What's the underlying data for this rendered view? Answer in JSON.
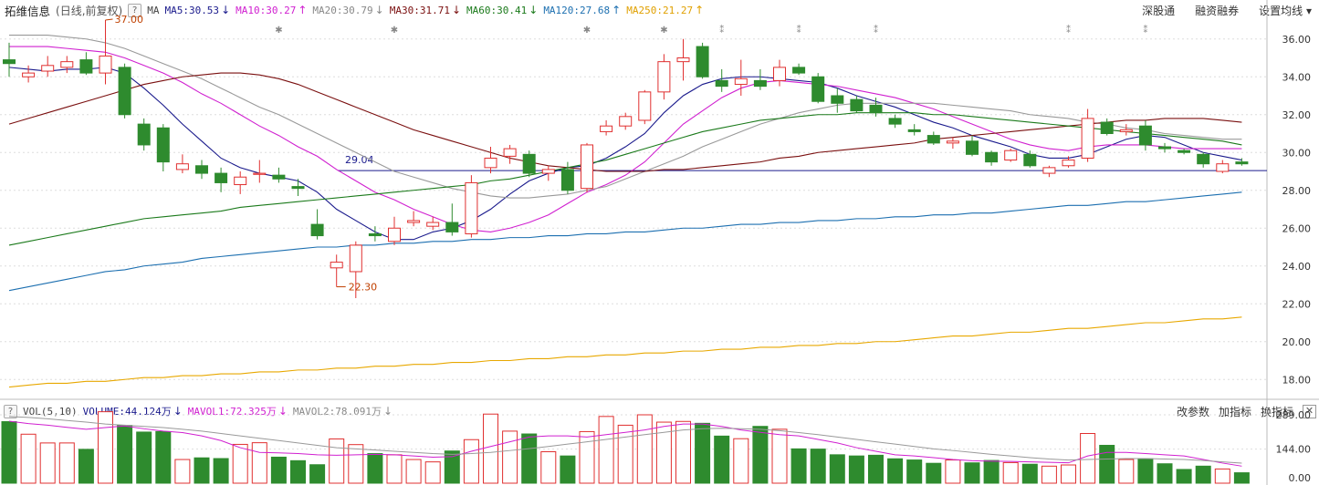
{
  "header": {
    "stock_name": "拓维信息",
    "mode": "(日线,前复权)",
    "help": "?",
    "ma_label": "MA",
    "ma_items": [
      {
        "label": "MA5:30.53",
        "arrow": "↓",
        "color": "#1a1a8c"
      },
      {
        "label": "MA10:30.27",
        "arrow": "↑",
        "color": "#d020d0"
      },
      {
        "label": "MA20:30.79",
        "arrow": "↓",
        "color": "#888888"
      },
      {
        "label": "MA30:31.71",
        "arrow": "↓",
        "color": "#7a0f0f"
      },
      {
        "label": "MA60:30.41",
        "arrow": "↓",
        "color": "#1b7a1b"
      },
      {
        "label": "MA120:27.68",
        "arrow": "↑",
        "color": "#1c6fb0"
      },
      {
        "label": "MA250:21.27",
        "arrow": "↑",
        "color": "#e0a000"
      }
    ],
    "links": [
      "深股通",
      "融资融券",
      "设置均线 ▾"
    ]
  },
  "volume_header": {
    "help": "?",
    "vol_label": "VOL(5,10)",
    "items": [
      {
        "label": "VOLUME:44.124万",
        "arrow": "↓",
        "color": "#1a1a8c"
      },
      {
        "label": "MAVOL1:72.325万",
        "arrow": "↓",
        "color": "#d020d0"
      },
      {
        "label": "MAVOL2:78.091万",
        "arrow": "↓",
        "color": "#888888"
      }
    ],
    "links": [
      "改参数",
      "加指标",
      "换指标"
    ],
    "close": "✕"
  },
  "chart_data": {
    "type": "candlestick",
    "price_axis": {
      "min": 17,
      "max": 37,
      "ticks": [
        "18.00",
        "20.00",
        "22.00",
        "24.00",
        "26.00",
        "28.00",
        "30.00",
        "32.00",
        "34.00",
        "36.00"
      ]
    },
    "volume_axis": {
      "max": 289,
      "ticks": [
        "0.00",
        "144.00",
        "289.00"
      ]
    },
    "colors": {
      "up": "#e03030",
      "down": "#2e8b2e",
      "grid": "#cccccc"
    },
    "annotations": [
      {
        "text": "37.00",
        "type": "high",
        "index": 5
      },
      {
        "text": "22.30",
        "type": "low",
        "index": 17
      },
      {
        "text": "29.04",
        "type": "hline",
        "value": 29.04
      }
    ],
    "candles": [
      {
        "o": 34.9,
        "h": 35.8,
        "l": 34.0,
        "c": 34.7,
        "v": 260
      },
      {
        "o": 34.0,
        "h": 34.6,
        "l": 33.7,
        "c": 34.2,
        "v": 207
      },
      {
        "o": 34.3,
        "h": 35.1,
        "l": 34.0,
        "c": 34.6,
        "v": 170
      },
      {
        "o": 34.5,
        "h": 35.1,
        "l": 34.2,
        "c": 34.8,
        "v": 170
      },
      {
        "o": 34.9,
        "h": 35.3,
        "l": 34.1,
        "c": 34.2,
        "v": 143
      },
      {
        "o": 34.2,
        "h": 37.0,
        "l": 33.6,
        "c": 35.1,
        "v": 302
      },
      {
        "o": 34.5,
        "h": 34.7,
        "l": 31.8,
        "c": 32.0,
        "v": 244
      },
      {
        "o": 31.5,
        "h": 31.8,
        "l": 30.1,
        "c": 30.4,
        "v": 216
      },
      {
        "o": 31.3,
        "h": 31.5,
        "l": 29.0,
        "c": 29.5,
        "v": 218
      },
      {
        "o": 29.1,
        "h": 29.9,
        "l": 28.9,
        "c": 29.4,
        "v": 100
      },
      {
        "o": 29.3,
        "h": 29.6,
        "l": 28.6,
        "c": 28.9,
        "v": 107
      },
      {
        "o": 28.9,
        "h": 29.2,
        "l": 27.9,
        "c": 28.4,
        "v": 104
      },
      {
        "o": 28.3,
        "h": 29.0,
        "l": 27.8,
        "c": 28.7,
        "v": 164
      },
      {
        "o": 28.9,
        "h": 29.6,
        "l": 28.4,
        "c": 28.9,
        "v": 171
      },
      {
        "o": 28.8,
        "h": 29.2,
        "l": 28.4,
        "c": 28.6,
        "v": 110
      },
      {
        "o": 28.2,
        "h": 28.6,
        "l": 27.7,
        "c": 28.1,
        "v": 95
      },
      {
        "o": 26.2,
        "h": 27.0,
        "l": 25.4,
        "c": 25.6,
        "v": 78
      },
      {
        "o": 23.9,
        "h": 24.6,
        "l": 22.9,
        "c": 24.2,
        "v": 187
      },
      {
        "o": 23.7,
        "h": 25.3,
        "l": 22.3,
        "c": 25.1,
        "v": 163
      },
      {
        "o": 25.7,
        "h": 26.1,
        "l": 25.3,
        "c": 25.6,
        "v": 125
      },
      {
        "o": 25.3,
        "h": 26.6,
        "l": 25.1,
        "c": 26.0,
        "v": 120
      },
      {
        "o": 26.3,
        "h": 26.9,
        "l": 26.1,
        "c": 26.4,
        "v": 100
      },
      {
        "o": 26.1,
        "h": 26.6,
        "l": 25.9,
        "c": 26.3,
        "v": 90
      },
      {
        "o": 26.3,
        "h": 27.3,
        "l": 25.6,
        "c": 25.8,
        "v": 136
      },
      {
        "o": 25.7,
        "h": 28.8,
        "l": 25.5,
        "c": 28.4,
        "v": 184
      },
      {
        "o": 29.2,
        "h": 30.3,
        "l": 28.9,
        "c": 29.7,
        "v": 292
      },
      {
        "o": 29.8,
        "h": 30.4,
        "l": 29.4,
        "c": 30.2,
        "v": 220
      },
      {
        "o": 29.9,
        "h": 30.1,
        "l": 28.7,
        "c": 28.9,
        "v": 208
      },
      {
        "o": 28.9,
        "h": 29.3,
        "l": 28.5,
        "c": 29.1,
        "v": 133
      },
      {
        "o": 29.1,
        "h": 29.5,
        "l": 27.8,
        "c": 28.0,
        "v": 115
      },
      {
        "o": 28.1,
        "h": 30.5,
        "l": 27.9,
        "c": 30.4,
        "v": 218
      },
      {
        "o": 31.1,
        "h": 31.7,
        "l": 30.9,
        "c": 31.4,
        "v": 282
      },
      {
        "o": 31.4,
        "h": 32.1,
        "l": 31.2,
        "c": 31.9,
        "v": 245
      },
      {
        "o": 31.7,
        "h": 33.3,
        "l": 31.5,
        "c": 33.2,
        "v": 289
      },
      {
        "o": 33.2,
        "h": 35.2,
        "l": 32.8,
        "c": 34.8,
        "v": 258
      },
      {
        "o": 34.8,
        "h": 36.0,
        "l": 33.8,
        "c": 35.0,
        "v": 261
      },
      {
        "o": 35.6,
        "h": 35.8,
        "l": 33.9,
        "c": 34.0,
        "v": 253
      },
      {
        "o": 33.8,
        "h": 34.4,
        "l": 33.2,
        "c": 33.5,
        "v": 199
      },
      {
        "o": 33.6,
        "h": 34.9,
        "l": 33.0,
        "c": 33.9,
        "v": 188
      },
      {
        "o": 33.8,
        "h": 34.4,
        "l": 33.3,
        "c": 33.5,
        "v": 240
      },
      {
        "o": 33.8,
        "h": 34.9,
        "l": 33.5,
        "c": 34.5,
        "v": 228
      },
      {
        "o": 34.5,
        "h": 34.7,
        "l": 34.1,
        "c": 34.2,
        "v": 145
      },
      {
        "o": 34.0,
        "h": 34.2,
        "l": 32.6,
        "c": 32.7,
        "v": 144
      },
      {
        "o": 33.0,
        "h": 33.4,
        "l": 32.1,
        "c": 32.6,
        "v": 120
      },
      {
        "o": 32.8,
        "h": 33.0,
        "l": 32.1,
        "c": 32.2,
        "v": 115
      },
      {
        "o": 32.5,
        "h": 32.9,
        "l": 31.9,
        "c": 32.1,
        "v": 118
      },
      {
        "o": 31.8,
        "h": 32.0,
        "l": 31.3,
        "c": 31.5,
        "v": 103
      },
      {
        "o": 31.2,
        "h": 31.5,
        "l": 30.9,
        "c": 31.1,
        "v": 98
      },
      {
        "o": 30.9,
        "h": 31.1,
        "l": 30.4,
        "c": 30.5,
        "v": 84
      },
      {
        "o": 30.5,
        "h": 30.8,
        "l": 30.2,
        "c": 30.6,
        "v": 98
      },
      {
        "o": 30.6,
        "h": 30.9,
        "l": 29.8,
        "c": 29.9,
        "v": 86
      },
      {
        "o": 30.0,
        "h": 30.1,
        "l": 29.3,
        "c": 29.5,
        "v": 96
      },
      {
        "o": 29.6,
        "h": 30.2,
        "l": 29.5,
        "c": 30.1,
        "v": 87
      },
      {
        "o": 29.9,
        "h": 30.1,
        "l": 29.2,
        "c": 29.3,
        "v": 80
      },
      {
        "o": 28.9,
        "h": 29.3,
        "l": 28.7,
        "c": 29.2,
        "v": 72
      },
      {
        "o": 29.3,
        "h": 29.8,
        "l": 29.2,
        "c": 29.6,
        "v": 77
      },
      {
        "o": 29.7,
        "h": 32.3,
        "l": 29.5,
        "c": 31.8,
        "v": 210
      },
      {
        "o": 31.6,
        "h": 31.8,
        "l": 30.9,
        "c": 31.0,
        "v": 160
      },
      {
        "o": 31.1,
        "h": 31.5,
        "l": 30.9,
        "c": 31.2,
        "v": 100
      },
      {
        "o": 31.4,
        "h": 31.7,
        "l": 30.1,
        "c": 30.4,
        "v": 103
      },
      {
        "o": 30.3,
        "h": 30.5,
        "l": 30.0,
        "c": 30.2,
        "v": 82
      },
      {
        "o": 30.1,
        "h": 30.2,
        "l": 29.9,
        "c": 30.0,
        "v": 58
      },
      {
        "o": 29.9,
        "h": 30.0,
        "l": 29.2,
        "c": 29.4,
        "v": 72
      },
      {
        "o": 29.0,
        "h": 29.6,
        "l": 28.9,
        "c": 29.4,
        "v": 60
      },
      {
        "o": 29.5,
        "h": 29.7,
        "l": 29.3,
        "c": 29.4,
        "v": 44
      }
    ],
    "ma_lines": {
      "MA5": [
        34.5,
        34.4,
        34.3,
        34.4,
        34.4,
        34.5,
        34.2,
        33.4,
        32.5,
        31.5,
        30.6,
        29.7,
        29.2,
        28.9,
        28.7,
        28.5,
        27.9,
        27.0,
        26.4,
        25.8,
        25.4,
        25.4,
        25.8,
        26.0,
        26.4,
        27.0,
        27.8,
        28.5,
        28.9,
        29.2,
        29.3,
        29.7,
        30.3,
        31.0,
        32.1,
        33.0,
        33.6,
        33.9,
        34.0,
        34.0,
        33.9,
        33.8,
        33.7,
        33.4,
        33.0,
        32.7,
        32.4,
        32.0,
        31.6,
        31.3,
        30.9,
        30.6,
        30.3,
        29.9,
        29.7,
        29.7,
        29.9,
        30.3,
        30.7,
        30.9,
        30.8,
        30.4,
        30.0,
        29.8,
        29.6
      ],
      "MA10": [
        35.6,
        35.6,
        35.6,
        35.5,
        35.4,
        35.3,
        35.0,
        34.6,
        34.2,
        33.7,
        33.1,
        32.6,
        32.0,
        31.4,
        30.9,
        30.3,
        29.8,
        29.1,
        28.5,
        27.9,
        27.5,
        27.0,
        26.6,
        26.2,
        25.9,
        25.8,
        26.0,
        26.3,
        26.7,
        27.3,
        27.9,
        28.3,
        28.8,
        29.5,
        30.5,
        31.5,
        32.2,
        32.9,
        33.4,
        33.7,
        33.8,
        33.7,
        33.6,
        33.5,
        33.3,
        33.1,
        32.9,
        32.6,
        32.3,
        31.9,
        31.5,
        31.1,
        30.7,
        30.4,
        30.2,
        30.1,
        30.3,
        30.4,
        30.4,
        30.4,
        30.3,
        30.2,
        30.2,
        30.2,
        30.2
      ],
      "MA20": [
        36.2,
        36.2,
        36.2,
        36.1,
        36.0,
        35.8,
        35.5,
        35.1,
        34.7,
        34.3,
        33.9,
        33.4,
        32.9,
        32.4,
        32.0,
        31.5,
        31.0,
        30.5,
        30.0,
        29.5,
        29.0,
        28.7,
        28.4,
        28.1,
        27.9,
        27.7,
        27.6,
        27.6,
        27.7,
        27.8,
        28.0,
        28.2,
        28.6,
        29.0,
        29.4,
        29.8,
        30.3,
        30.7,
        31.1,
        31.5,
        31.8,
        32.1,
        32.3,
        32.5,
        32.6,
        32.6,
        32.6,
        32.6,
        32.6,
        32.5,
        32.4,
        32.3,
        32.2,
        32.0,
        31.9,
        31.8,
        31.6,
        31.5,
        31.3,
        31.2,
        31.0,
        30.9,
        30.8,
        30.7,
        30.7
      ],
      "MA30": [
        31.5,
        31.8,
        32.1,
        32.4,
        32.7,
        33.0,
        33.3,
        33.6,
        33.8,
        34.0,
        34.1,
        34.2,
        34.2,
        34.1,
        33.9,
        33.6,
        33.2,
        32.8,
        32.4,
        32.0,
        31.6,
        31.2,
        30.9,
        30.6,
        30.3,
        30.0,
        29.7,
        29.5,
        29.3,
        29.2,
        29.1,
        29.0,
        29.0,
        29.0,
        29.1,
        29.1,
        29.2,
        29.3,
        29.4,
        29.5,
        29.7,
        29.8,
        30.0,
        30.1,
        30.2,
        30.3,
        30.4,
        30.5,
        30.7,
        30.8,
        30.9,
        31.0,
        31.1,
        31.2,
        31.3,
        31.4,
        31.5,
        31.6,
        31.7,
        31.7,
        31.8,
        31.8,
        31.8,
        31.7,
        31.6
      ],
      "MA60": [
        25.1,
        25.3,
        25.5,
        25.7,
        25.9,
        26.1,
        26.3,
        26.5,
        26.6,
        26.7,
        26.8,
        26.9,
        27.1,
        27.2,
        27.3,
        27.4,
        27.5,
        27.6,
        27.7,
        27.8,
        27.9,
        28.0,
        28.1,
        28.2,
        28.3,
        28.5,
        28.6,
        28.8,
        29.0,
        29.2,
        29.4,
        29.6,
        29.9,
        30.2,
        30.5,
        30.8,
        31.1,
        31.3,
        31.5,
        31.7,
        31.8,
        31.9,
        32.0,
        32.0,
        32.1,
        32.1,
        32.1,
        32.1,
        32.0,
        32.0,
        31.9,
        31.8,
        31.7,
        31.6,
        31.5,
        31.4,
        31.3,
        31.2,
        31.1,
        31.0,
        30.9,
        30.8,
        30.7,
        30.6,
        30.4
      ],
      "MA120": [
        22.7,
        22.9,
        23.1,
        23.3,
        23.5,
        23.7,
        23.8,
        24.0,
        24.1,
        24.2,
        24.4,
        24.5,
        24.6,
        24.7,
        24.8,
        24.9,
        25.0,
        25.0,
        25.1,
        25.1,
        25.2,
        25.2,
        25.3,
        25.3,
        25.4,
        25.4,
        25.5,
        25.5,
        25.6,
        25.6,
        25.7,
        25.7,
        25.8,
        25.8,
        25.9,
        26.0,
        26.0,
        26.1,
        26.2,
        26.2,
        26.3,
        26.3,
        26.4,
        26.4,
        26.5,
        26.5,
        26.6,
        26.6,
        26.7,
        26.7,
        26.8,
        26.8,
        26.9,
        27.0,
        27.1,
        27.2,
        27.2,
        27.3,
        27.4,
        27.4,
        27.5,
        27.6,
        27.7,
        27.8,
        27.9
      ],
      "MA250": [
        17.6,
        17.7,
        17.8,
        17.8,
        17.9,
        17.9,
        18.0,
        18.1,
        18.1,
        18.2,
        18.2,
        18.3,
        18.3,
        18.4,
        18.4,
        18.5,
        18.5,
        18.6,
        18.6,
        18.7,
        18.7,
        18.8,
        18.8,
        18.9,
        18.9,
        19.0,
        19.0,
        19.1,
        19.1,
        19.2,
        19.2,
        19.3,
        19.3,
        19.4,
        19.4,
        19.5,
        19.5,
        19.6,
        19.6,
        19.7,
        19.7,
        19.8,
        19.8,
        19.9,
        19.9,
        20.0,
        20.0,
        20.1,
        20.2,
        20.3,
        20.3,
        20.4,
        20.5,
        20.5,
        20.6,
        20.7,
        20.7,
        20.8,
        20.9,
        21.0,
        21.0,
        21.1,
        21.2,
        21.2,
        21.3
      ]
    },
    "vol_lines": {
      "MAVOL1": [
        262,
        252,
        245,
        236,
        228,
        235,
        242,
        230,
        220,
        214,
        200,
        180,
        150,
        130,
        128,
        125,
        120,
        118,
        120,
        122,
        120,
        115,
        110,
        112,
        135,
        155,
        175,
        195,
        200,
        200,
        195,
        205,
        215,
        225,
        240,
        250,
        250,
        240,
        225,
        215,
        205,
        200,
        185,
        170,
        150,
        135,
        120,
        115,
        108,
        100,
        95,
        93,
        92,
        90,
        88,
        86,
        115,
        130,
        130,
        125,
        120,
        115,
        100,
        85,
        72
      ],
      "MAVOL2": [
        282,
        278,
        272,
        265,
        258,
        250,
        245,
        240,
        235,
        228,
        220,
        210,
        200,
        190,
        180,
        170,
        160,
        150,
        145,
        140,
        135,
        130,
        125,
        122,
        125,
        130,
        138,
        146,
        155,
        165,
        175,
        185,
        195,
        205,
        215,
        225,
        230,
        232,
        230,
        228,
        222,
        214,
        205,
        195,
        185,
        175,
        165,
        155,
        145,
        138,
        130,
        122,
        115,
        108,
        102,
        98,
        100,
        102,
        104,
        104,
        102,
        100,
        96,
        90,
        85
      ]
    }
  }
}
